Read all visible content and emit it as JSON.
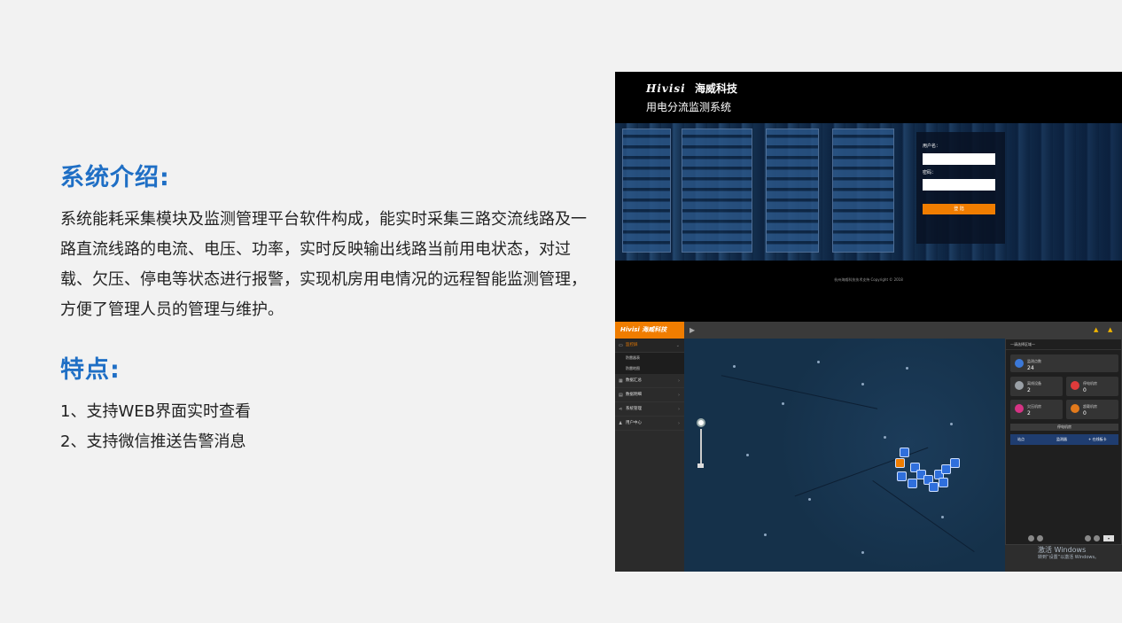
{
  "intro": {
    "heading": "系统介绍:",
    "text": "系统能耗采集模块及监测管理平台软件构成，能实时采集三路交流线路及一路直流线路的电流、电压、功率，实时反映输出线路当前用电状态，对过载、欠压、停电等状态进行报警，实现机房用电情况的远程智能监测管理， 方便了管理人员的管理与维护。"
  },
  "features": {
    "heading": "特点:",
    "items": [
      "1、支持WEB界面实时查看",
      "2、支持微信推送告警消息"
    ]
  },
  "login_screen": {
    "brand_logo": "Hivisi",
    "brand_cn": "海威科技",
    "system_title": "用电分流监测系统",
    "username_label": "用户名：",
    "password_label": "密码：",
    "login_button": "登 陆",
    "copyright": "杭州海威科技技术支持 Copyright © 2018"
  },
  "dashboard": {
    "brand_logo": "Hivisi 海威科技",
    "menu": [
      {
        "icon": "monitor-icon",
        "label": "监控屏",
        "active": true
      },
      {
        "icon": "chart-icon",
        "label": "数据汇总",
        "active": false
      },
      {
        "icon": "grid-icon",
        "label": "数据明细",
        "active": false
      },
      {
        "icon": "share-icon",
        "label": "系统管理",
        "active": false
      },
      {
        "icon": "user-icon",
        "label": "用户中心",
        "active": false
      }
    ],
    "submenu": [
      "防雷器表",
      "防雷地图"
    ],
    "panel_header": "—请选择区域—",
    "cards": [
      {
        "label": "监测点数",
        "value": "24",
        "color": "#3b78d8"
      },
      {
        "label": "离线设备",
        "value": "2",
        "color": "#9aa0a6"
      },
      {
        "label": "停电机房",
        "value": "0",
        "color": "#e03b3b"
      },
      {
        "label": "欠压机房",
        "value": "2",
        "color": "#d63384"
      },
      {
        "label": "超载机房",
        "value": "0",
        "color": "#e27a1c"
      }
    ],
    "outage_button": "停电机房",
    "table_columns": [
      "站点",
      "监测器",
      "+ 在线板卡"
    ],
    "watermark": "激活 Windows",
    "watermark_sub": "转到“设置”以激活 Windows。"
  }
}
